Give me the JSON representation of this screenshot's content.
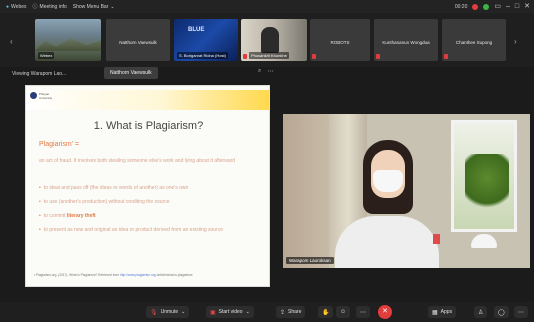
{
  "titlebar": {
    "app_name": "Webex",
    "meeting_info_label": "Meeting info",
    "menu_bar_label": "Show Menu Bar",
    "time": "00:20"
  },
  "participants": [
    {
      "label": "Webex",
      "muted": false
    },
    {
      "label": "Natthorn Vaewsulk",
      "muted": false
    },
    {
      "label": "S. Boriganrat Ridna (Host)",
      "muted": false
    },
    {
      "label": "Phusankrit Khonkhe",
      "muted": true
    },
    {
      "label": "ROBOTS",
      "muted": true
    },
    {
      "label": "Kunthananun Wongdua",
      "muted": true
    },
    {
      "label": "Chanthee Supong",
      "muted": true
    }
  ],
  "view": {
    "viewing_label": "Viewing Warapom Lao...",
    "tooltip": "Natthorn Vaewsulk"
  },
  "slide": {
    "org_line1": "Phayao",
    "org_line2": "University",
    "title": "1. What is Plagiarism?",
    "term": "Plagiarism' =",
    "definition": "an act of fraud. It involves both stealing someone else's work and lying about it afterward",
    "bullets": [
      {
        "pre": "to steal and pass off (the ideas or words of another) as one's own",
        "bold": "",
        "post": ""
      },
      {
        "pre": "to use (another's production) without crediting the source",
        "bold": "",
        "post": ""
      },
      {
        "pre": "to commit ",
        "bold": "literary theft",
        "post": ""
      },
      {
        "pre": "to present as new and original an idea or product derived from an existing source",
        "bold": "",
        "post": ""
      }
    ],
    "reference_pre": "• Plagiarism.org. (2017). What is Plagiarism? Retrieved from ",
    "reference_link": "http://www.plagiarism.org",
    "reference_post": " /article/what-is-plagiarism"
  },
  "speaker": {
    "name": "Warapom Laoroksan"
  },
  "toolbar": {
    "unmute_label": "Unmute",
    "start_video_label": "Start video",
    "share_label": "Share",
    "apps_label": "Apps"
  },
  "colors": {
    "accent_orange": "#e07a45",
    "end_red": "#e23d3d",
    "mute_red": "#e24848"
  }
}
